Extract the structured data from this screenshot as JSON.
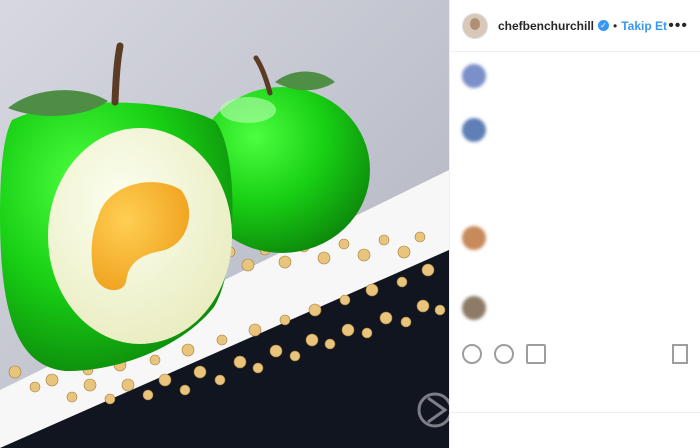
{
  "header": {
    "username": "chefbenchurchill",
    "verified_glyph": "✓",
    "separator": "•",
    "follow_label": "Takip Et",
    "more_glyph": "•••"
  },
  "photo": {
    "description_icon": "apple-dessert-image"
  },
  "comments": [
    {
      "text": "",
      "meta": "",
      "avatar_color": "#7b8fc9"
    },
    {
      "text": "",
      "meta": "",
      "avatar_color": "#5f7fb6"
    },
    {
      "text": "",
      "meta": "",
      "avatar_color": "#c78a5b"
    },
    {
      "text": "",
      "meta": "",
      "avatar_color": "#8d7b68"
    }
  ],
  "actions": {
    "like_icon": "heart-icon",
    "comment_icon": "comment-icon",
    "share_icon": "share-icon",
    "save_icon": "bookmark-icon"
  },
  "likes": "",
  "time_ago": "",
  "add_comment": {
    "placeholder": "",
    "post_label": ""
  },
  "colors": {
    "accent": "#3897f0",
    "apple_green": "#1fd21a"
  }
}
